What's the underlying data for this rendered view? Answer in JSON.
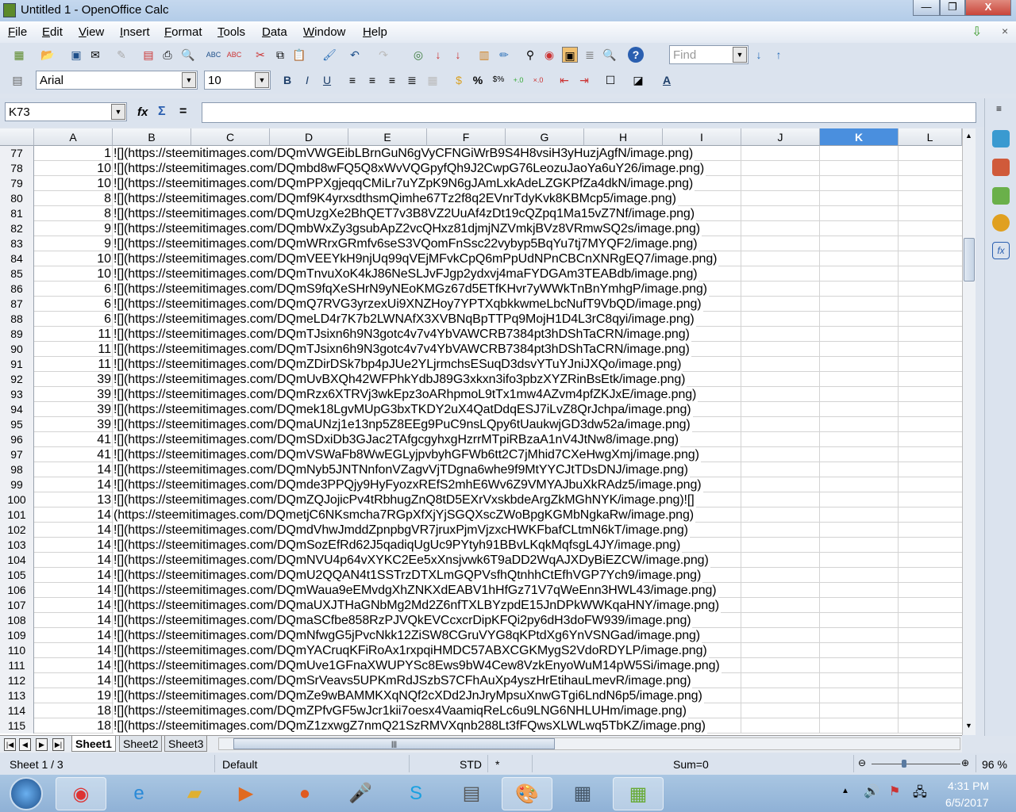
{
  "window": {
    "title": "Untitled 1 - OpenOffice Calc",
    "minimize": "—",
    "restore": "❐",
    "close": "X"
  },
  "menu": [
    "File",
    "Edit",
    "View",
    "Insert",
    "Format",
    "Tools",
    "Data",
    "Window",
    "Help"
  ],
  "toolbar": {
    "find_placeholder": "Find",
    "font_name": "Arial",
    "font_size": "10",
    "bold": "B",
    "italic": "I",
    "underline": "U",
    "percent": "%"
  },
  "formula": {
    "name_box": "K73",
    "function_wizard": "fx",
    "sum": "Σ",
    "equals": "=",
    "content": ""
  },
  "columns": [
    "A",
    "B",
    "C",
    "D",
    "E",
    "F",
    "G",
    "H",
    "I",
    "J",
    "K",
    "L"
  ],
  "selected_column": "K",
  "rows": [
    {
      "n": "77",
      "a": "1",
      "b": "![](https://steemitimages.com/DQmVWGEibLBrnGuN6gVyCFNGiWrB9S4H8vsiH3yHuzjAgfN/image.png)"
    },
    {
      "n": "78",
      "a": "10",
      "b": "![](https://steemitimages.com/DQmbd8wFQ5Q8xWvVQGpyfQh9J2CwpG76LeozuJaoYa6uY26/image.png)"
    },
    {
      "n": "79",
      "a": "10",
      "b": "![](https://steemitimages.com/DQmPPXgjeqqCMiLr7uYZpK9N6gJAmLxkAdeLZGKPfZa4dkN/image.png)"
    },
    {
      "n": "80",
      "a": "8",
      "b": "![](https://steemitimages.com/DQmf9K4yrxsdthsmQimhe67Tz2f8q2EVnrTdyKvk8KBMcp5/image.png)"
    },
    {
      "n": "81",
      "a": "8",
      "b": "![](https://steemitimages.com/DQmUzgXe2BhQET7v3B8VZ2UuAf4zDt19cQZpq1Ma15vZ7Nf/image.png)"
    },
    {
      "n": "82",
      "a": "9",
      "b": "![](https://steemitimages.com/DQmbWxZy3gsubApZ2vcQHxz81djmjNZVmkjBVz8VRmwSQ2s/image.png)"
    },
    {
      "n": "83",
      "a": "9",
      "b": "![](https://steemitimages.com/DQmWRrxGRmfv6seS3VQomFnSsc22vybyp5BqYu7tj7MYQF2/image.png)"
    },
    {
      "n": "84",
      "a": "10",
      "b": "![](https://steemitimages.com/DQmVEEYkH9njUq99qVEjMFvkCpQ6mPpUdNPnCBCnXNRgEQ7/image.png)"
    },
    {
      "n": "85",
      "a": "10",
      "b": "![](https://steemitimages.com/DQmTnvuXoK4kJ86NeSLJvFJgp2ydxvj4maFYDGAm3TEABdb/image.png)"
    },
    {
      "n": "86",
      "a": "6",
      "b": "![](https://steemitimages.com/DQmS9fqXeSHrN9yNEoKMGz67d5ETfKHvr7yWWkTnBnYmhgP/image.png)"
    },
    {
      "n": "87",
      "a": "6",
      "b": "![](https://steemitimages.com/DQmQ7RVG3yrzexUi9XNZHoy7YPTXqbkkwmeLbcNufT9VbQD/image.png)"
    },
    {
      "n": "88",
      "a": "6",
      "b": "![](https://steemitimages.com/DQmeLD4r7K7b2LWNAfX3XVBNqBpTTPq9MojH1D4L3rC8qyi/image.png)"
    },
    {
      "n": "89",
      "a": "11",
      "b": "![](https://steemitimages.com/DQmTJsixn6h9N3gotc4v7v4YbVAWCRB7384pt3hDShTaCRN/image.png)"
    },
    {
      "n": "90",
      "a": "11",
      "b": "![](https://steemitimages.com/DQmTJsixn6h9N3gotc4v7v4YbVAWCRB7384pt3hDShTaCRN/image.png)"
    },
    {
      "n": "91",
      "a": "11",
      "b": "![](https://steemitimages.com/DQmZDirDSk7bp4pJUe2YLjrmchsESuqD3dsvYTuYJniJXQo/image.png)"
    },
    {
      "n": "92",
      "a": "39",
      "b": "![](https://steemitimages.com/DQmUvBXQh42WFPhkYdbJ89G3xkxn3ifo3pbzXYZRinBsEtk/image.png)"
    },
    {
      "n": "93",
      "a": "39",
      "b": "![](https://steemitimages.com/DQmRzx6XTRVj3wkEpz3oARhpmoL9tTx1mw4AZvm4pfZKJxE/image.png)"
    },
    {
      "n": "94",
      "a": "39",
      "b": "![](https://steemitimages.com/DQmek18LgvMUpG3bxTKDY2uX4QatDdqESJ7iLvZ8QrJchpa/image.png)"
    },
    {
      "n": "95",
      "a": "39",
      "b": "![](https://steemitimages.com/DQmaUNzj1e13np5Z8EEg9PuC9nsLQpy6tUaukwjGD3dw52a/image.png)"
    },
    {
      "n": "96",
      "a": "41",
      "b": "![](https://steemitimages.com/DQmSDxiDb3GJac2TAfgcgyhxgHzrrMTpiRBzaA1nV4JtNw8/image.png)"
    },
    {
      "n": "97",
      "a": "41",
      "b": "![](https://steemitimages.com/DQmVSWaFb8WwEGLyjpvbyhGFWb6tt2C7jMhid7CXeHwgXmj/image.png)"
    },
    {
      "n": "98",
      "a": "14",
      "b": "![](https://steemitimages.com/DQmNyb5JNTNnfonVZagvVjTDgna6whe9f9MtYYCJtTDsDNJ/image.png)"
    },
    {
      "n": "99",
      "a": "14",
      "b": "![](https://steemitimages.com/DQmde3PPQjy9HyFyozxREfS2mhE6Wv6Z9VMYAJbuXkRAdz5/image.png)"
    },
    {
      "n": "100",
      "a": "13",
      "b": "![](https://steemitimages.com/DQmZQJojicPv4tRbhugZnQ8tD5EXrVxskbdeArgZkMGhNYK/image.png)![]"
    },
    {
      "n": "101",
      "a": "14",
      "b": "(https://steemitimages.com/DQmetjC6NKsmcha7RGpXfXjYjSGQXscZWoBpgKGMbNgkaRw/image.png)"
    },
    {
      "n": "102",
      "a": "14",
      "b": "![](https://steemitimages.com/DQmdVhwJmddZpnpbgVR7jruxPjmVjzxcHWKFbafCLtmN6kT/image.png)"
    },
    {
      "n": "103",
      "a": "14",
      "b": "![](https://steemitimages.com/DQmSozEfRd62J5qadiqUgUc9PYtyh91BBvLKqkMqfsgL4JY/image.png)"
    },
    {
      "n": "104",
      "a": "14",
      "b": "![](https://steemitimages.com/DQmNVU4p64vXYKC2Ee5xXnsjvwk6T9aDD2WqAJXDyBiEZCW/image.png)"
    },
    {
      "n": "105",
      "a": "14",
      "b": "![](https://steemitimages.com/DQmU2QQAN4t1SSTrzDTXLmGQPVsfhQtnhhCtEfhVGP7Ych9/image.png)"
    },
    {
      "n": "106",
      "a": "14",
      "b": "![](https://steemitimages.com/DQmWaua9eEMvdgXhZNKXdEABV1hHfGz71V7qWeEnn3HWL43/image.png)"
    },
    {
      "n": "107",
      "a": "14",
      "b": "![](https://steemitimages.com/DQmaUXJTHaGNbMg2Md2Z6nfTXLBYzpdE15JnDPkWWKqaHNY/image.png)"
    },
    {
      "n": "108",
      "a": "14",
      "b": "![](https://steemitimages.com/DQmaSCfbe858RzPJVQkEVCcxcrDipKFQi2py6dH3doFW939/image.png)"
    },
    {
      "n": "109",
      "a": "14",
      "b": "![](https://steemitimages.com/DQmNfwgG5jPvcNkk12ZiSW8CGruVYG8qKPtdXg6YnVSNGad/image.png)"
    },
    {
      "n": "110",
      "a": "14",
      "b": "![](https://steemitimages.com/DQmYACruqKFiRoAx1rxpqiHMDC57ABXCGKMygS2VdoRDYLP/image.png)"
    },
    {
      "n": "111",
      "a": "14",
      "b": "![](https://steemitimages.com/DQmUve1GFnaXWUPYSc8Ews9bW4Cew8VzkEnyoWuM14pW5Si/image.png)"
    },
    {
      "n": "112",
      "a": "14",
      "b": "![](https://steemitimages.com/DQmSrVeavs5UPKmRdJSzbS7CFhAuXp4yszHrEtihauLmevR/image.png)"
    },
    {
      "n": "113",
      "a": "19",
      "b": "![](https://steemitimages.com/DQmZe9wBAMMKXqNQf2cXDd2JnJryMpsuXnwGTgi6LndN6p5/image.png)"
    },
    {
      "n": "114",
      "a": "18",
      "b": "![](https://steemitimages.com/DQmZPfvGF5wJcr1kii7oesx4VaamiqReLc6u9LNG6NHLUHm/image.png)"
    },
    {
      "n": "115",
      "a": "18",
      "b": "![](https://steemitimages.com/DQmZ1zxwgZ7nmQ21SzRMVXqnb288Lt3fFQwsXLWLwq5TbKZ/image.png)"
    }
  ],
  "sheets": [
    "Sheet1",
    "Sheet2",
    "Sheet3"
  ],
  "status": {
    "sheet": "Sheet 1 / 3",
    "style": "Default",
    "mode": "STD",
    "modified": "*",
    "sum": "Sum=0",
    "zoom": "96 %",
    "zoom_level": 96
  },
  "taskbar": {
    "time": "4:31 PM",
    "date": "6/5/2017"
  },
  "colors": {
    "selected_col": "#4a8fde",
    "close_btn": "#c9453a"
  }
}
